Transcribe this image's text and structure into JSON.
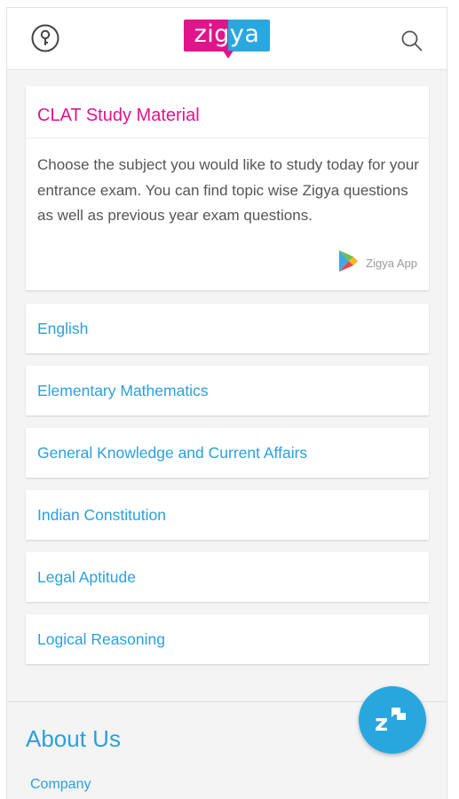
{
  "header": {
    "logo_text": "zigya",
    "login_icon": "key-circle-icon",
    "search_icon": "search-icon"
  },
  "intro": {
    "title": "CLAT Study Material",
    "description": "Choose the subject you would like to study today for your entrance exam. You can find topic wise Zigya questions as well as previous year exam questions.",
    "app_badge_label": "Zigya App",
    "app_badge_icon": "play-store-icon"
  },
  "subjects": [
    {
      "label": "English"
    },
    {
      "label": "Elementary Mathematics"
    },
    {
      "label": "General Knowledge and Current Affairs"
    },
    {
      "label": "Indian Constitution"
    },
    {
      "label": "Legal Aptitude"
    },
    {
      "label": "Logical Reasoning"
    }
  ],
  "footer": {
    "about_heading": "About Us",
    "company_link": "Company"
  },
  "fab": {
    "icon": "zigya-chat-icon"
  },
  "colors": {
    "brand_pink": "#e1148c",
    "brand_blue": "#29a8df",
    "link_blue": "#2ba0dd",
    "body_text": "#555555",
    "page_bg": "#f4f4f4"
  }
}
